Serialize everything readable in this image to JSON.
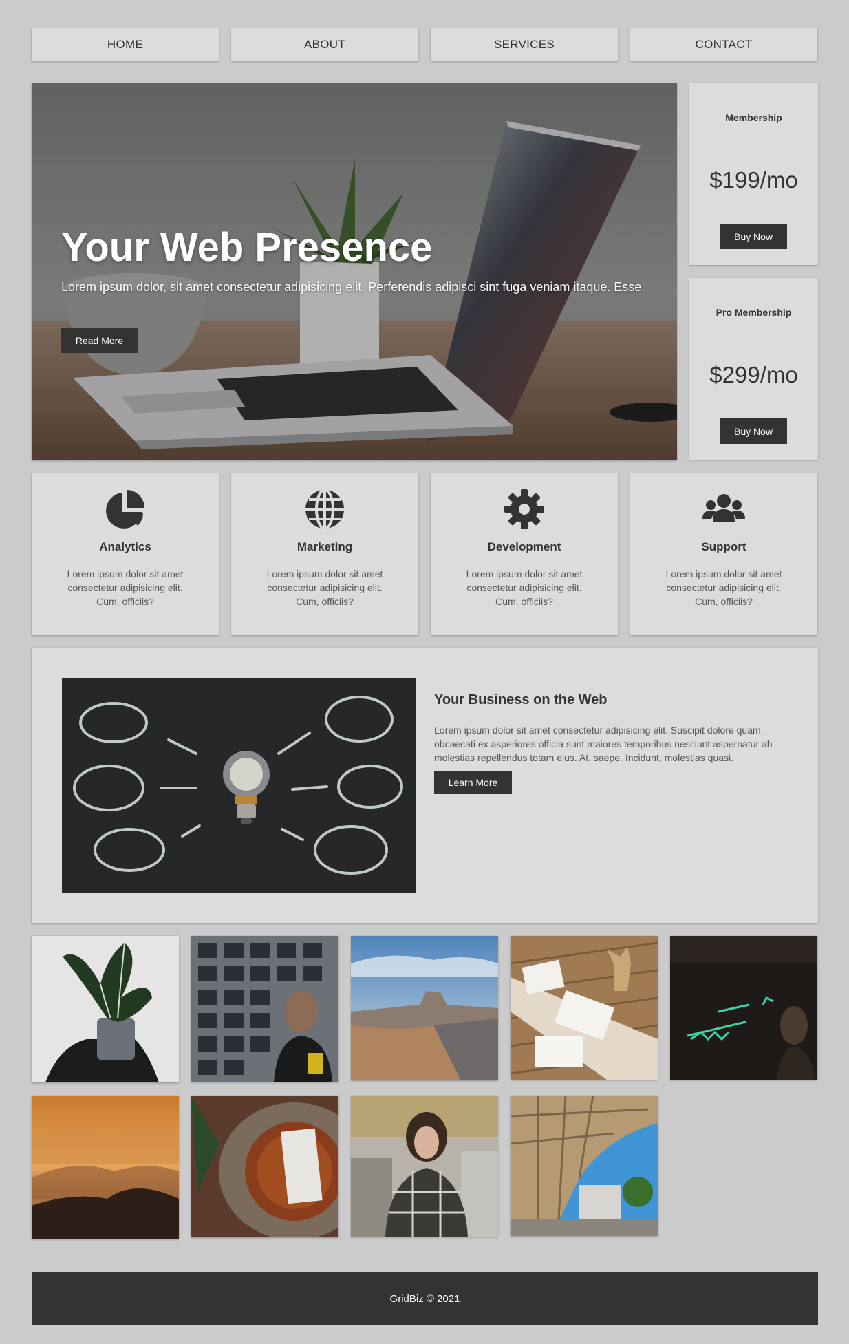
{
  "nav": {
    "items": [
      {
        "label": "HOME"
      },
      {
        "label": "ABOUT"
      },
      {
        "label": "SERVICES"
      },
      {
        "label": "CONTACT"
      }
    ]
  },
  "hero": {
    "title": "Your Web Presence",
    "text": "Lorem ipsum dolor, sit amet consectetur adipisicing elit. Perferendis adipisci sint fuga veniam itaque. Esse.",
    "button": "Read More"
  },
  "pricing": [
    {
      "name": "Membership",
      "price": "$199/mo",
      "button": "Buy Now"
    },
    {
      "name": "Pro Membership",
      "price": "$299/mo",
      "button": "Buy Now"
    }
  ],
  "services": [
    {
      "icon": "pie-chart-icon",
      "title": "Analytics",
      "text": "Lorem ipsum dolor sit amet consectetur adipisicing elit. Cum, officiis?"
    },
    {
      "icon": "globe-icon",
      "title": "Marketing",
      "text": "Lorem ipsum dolor sit amet consectetur adipisicing elit. Cum, officiis?"
    },
    {
      "icon": "gear-icon",
      "title": "Development",
      "text": "Lorem ipsum dolor sit amet consectetur adipisicing elit. Cum, officiis?"
    },
    {
      "icon": "users-icon",
      "title": "Support",
      "text": "Lorem ipsum dolor sit amet consectetur adipisicing elit. Cum, officiis?"
    }
  ],
  "feature": {
    "title": "Your Business on the Web",
    "text": "Lorem ipsum dolor sit amet consectetur adipisicing elit. Suscipit dolore quam, obcaecati ex asperiores officia sunt maiores temporibus nesciunt aspernatur ab molestias repellendus totam eius. At, saepe. Incidunt, molestias quasi.",
    "button": "Learn More"
  },
  "footer": {
    "text": "GridBiz © 2021"
  },
  "colors": {
    "page_bg": "#cbcbcb",
    "card_bg": "#dcdcdc",
    "dark": "#333333"
  }
}
